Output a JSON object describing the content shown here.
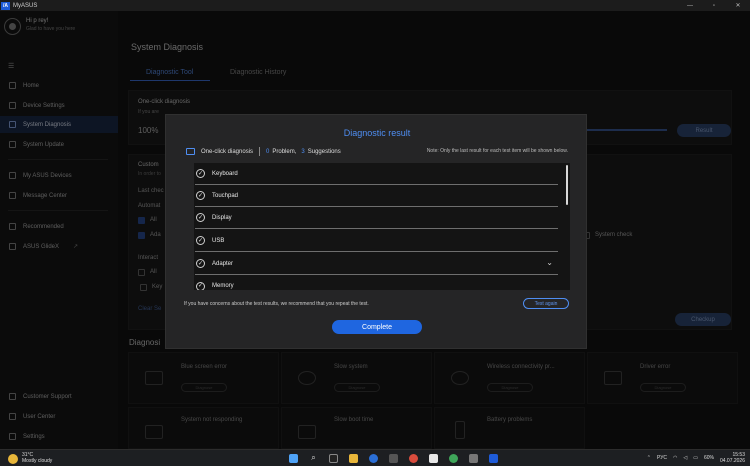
{
  "window": {
    "title": "MyASUS",
    "logo": "/A",
    "controls": [
      "—",
      "▫",
      "✕"
    ]
  },
  "user": {
    "greeting": "Hi p rey!",
    "subtitle": "Glad to have you here"
  },
  "sidebar": {
    "menu_icon": "☰",
    "items": [
      {
        "label": "Home",
        "icon": "home-icon"
      },
      {
        "label": "Device Settings",
        "icon": "grid-icon"
      },
      {
        "label": "System Diagnosis",
        "icon": "diagnosis-icon",
        "active": true
      },
      {
        "label": "System Update",
        "icon": "update-icon"
      },
      {
        "label": "My ASUS Devices",
        "icon": "devices-icon"
      },
      {
        "label": "Message Center",
        "icon": "message-icon"
      },
      {
        "label": "Recommended",
        "icon": "star-icon"
      },
      {
        "label": "ASUS GlideX",
        "icon": "glidex-icon",
        "external": "↗"
      }
    ],
    "bottom_items": [
      {
        "label": "Customer Support",
        "icon": "support-icon"
      },
      {
        "label": "User Center",
        "icon": "user-icon"
      },
      {
        "label": "Settings",
        "icon": "gear-icon"
      }
    ]
  },
  "main": {
    "title": "System Diagnosis",
    "tabs": [
      "Diagnostic Tool",
      "Diagnostic History"
    ],
    "one_click": {
      "title": "One-click diagnosis",
      "desc": "If you are",
      "progress": "100%",
      "button": "Result"
    },
    "custom": {
      "title": "Custom",
      "desc": "In order to",
      "last_check": "Last chec",
      "automatic": "Automat",
      "all": "All",
      "ada": "Ada",
      "interactive": "Interact",
      "all2": "All",
      "key": "Key",
      "clear": "Clear Se",
      "system_check": "System check",
      "checkup": "Checkup"
    },
    "diagnosis_section": "Diagnosi",
    "issues": [
      {
        "name": "Blue screen error",
        "button": "Diagnose"
      },
      {
        "name": "Slow system",
        "button": "Diagnose"
      },
      {
        "name": "Wireless connectivity pr...",
        "button": "Diagnose"
      },
      {
        "name": "Driver error",
        "button": "Diagnose"
      },
      {
        "name": "System not responding",
        "button": ""
      },
      {
        "name": "Slow boot time",
        "button": ""
      },
      {
        "name": "Battery problems",
        "button": ""
      }
    ]
  },
  "modal": {
    "title": "Diagnostic result",
    "summary_label": "One-click diagnosis",
    "problems_count": "0",
    "problems_label": "Problem,",
    "suggestions_count": "3",
    "suggestions_label": "Suggestions",
    "note": "Note: Only the last result for each test item will be shown below.",
    "items": [
      {
        "label": "Keyboard"
      },
      {
        "label": "Touchpad"
      },
      {
        "label": "Display"
      },
      {
        "label": "USB"
      },
      {
        "label": "Adapter",
        "expandable": true
      },
      {
        "label": "Memory"
      }
    ],
    "footnote": "If you have concerns about the test results, we recommend that you repeat the test.",
    "test_again": "Test again",
    "complete": "Complete"
  },
  "taskbar": {
    "weather_temp": "31°C",
    "weather_desc": "Mostly cloudy",
    "lang": "РУС",
    "battery": "60%",
    "time": "15:53",
    "date": "04.07.2026",
    "colors": {
      "accent": "#1f66e0",
      "modal_title": "#4f8ef2"
    }
  }
}
